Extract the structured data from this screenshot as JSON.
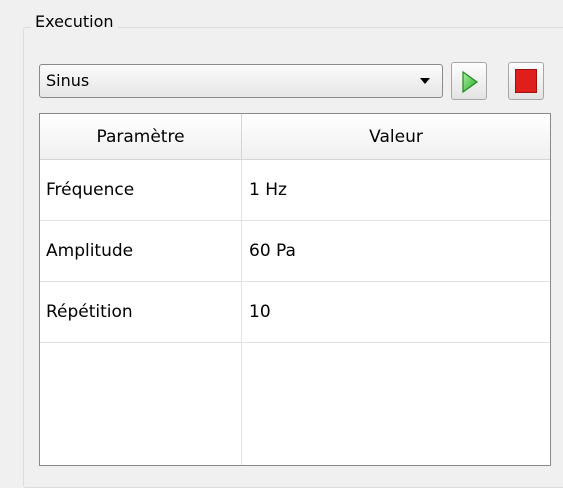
{
  "group": {
    "title": "Execution"
  },
  "combo": {
    "selected": "Sinus"
  },
  "buttons": {
    "play_icon": "play-icon",
    "stop_icon": "stop-icon",
    "play_color": "#3cc23c",
    "stop_color": "#e01e1e"
  },
  "table": {
    "headers": [
      "Paramètre",
      "Valeur"
    ],
    "rows": [
      {
        "param": "Fréquence",
        "value": "1 Hz"
      },
      {
        "param": "Amplitude",
        "value": "60 Pa"
      },
      {
        "param": "Répétition",
        "value": "10"
      }
    ]
  }
}
